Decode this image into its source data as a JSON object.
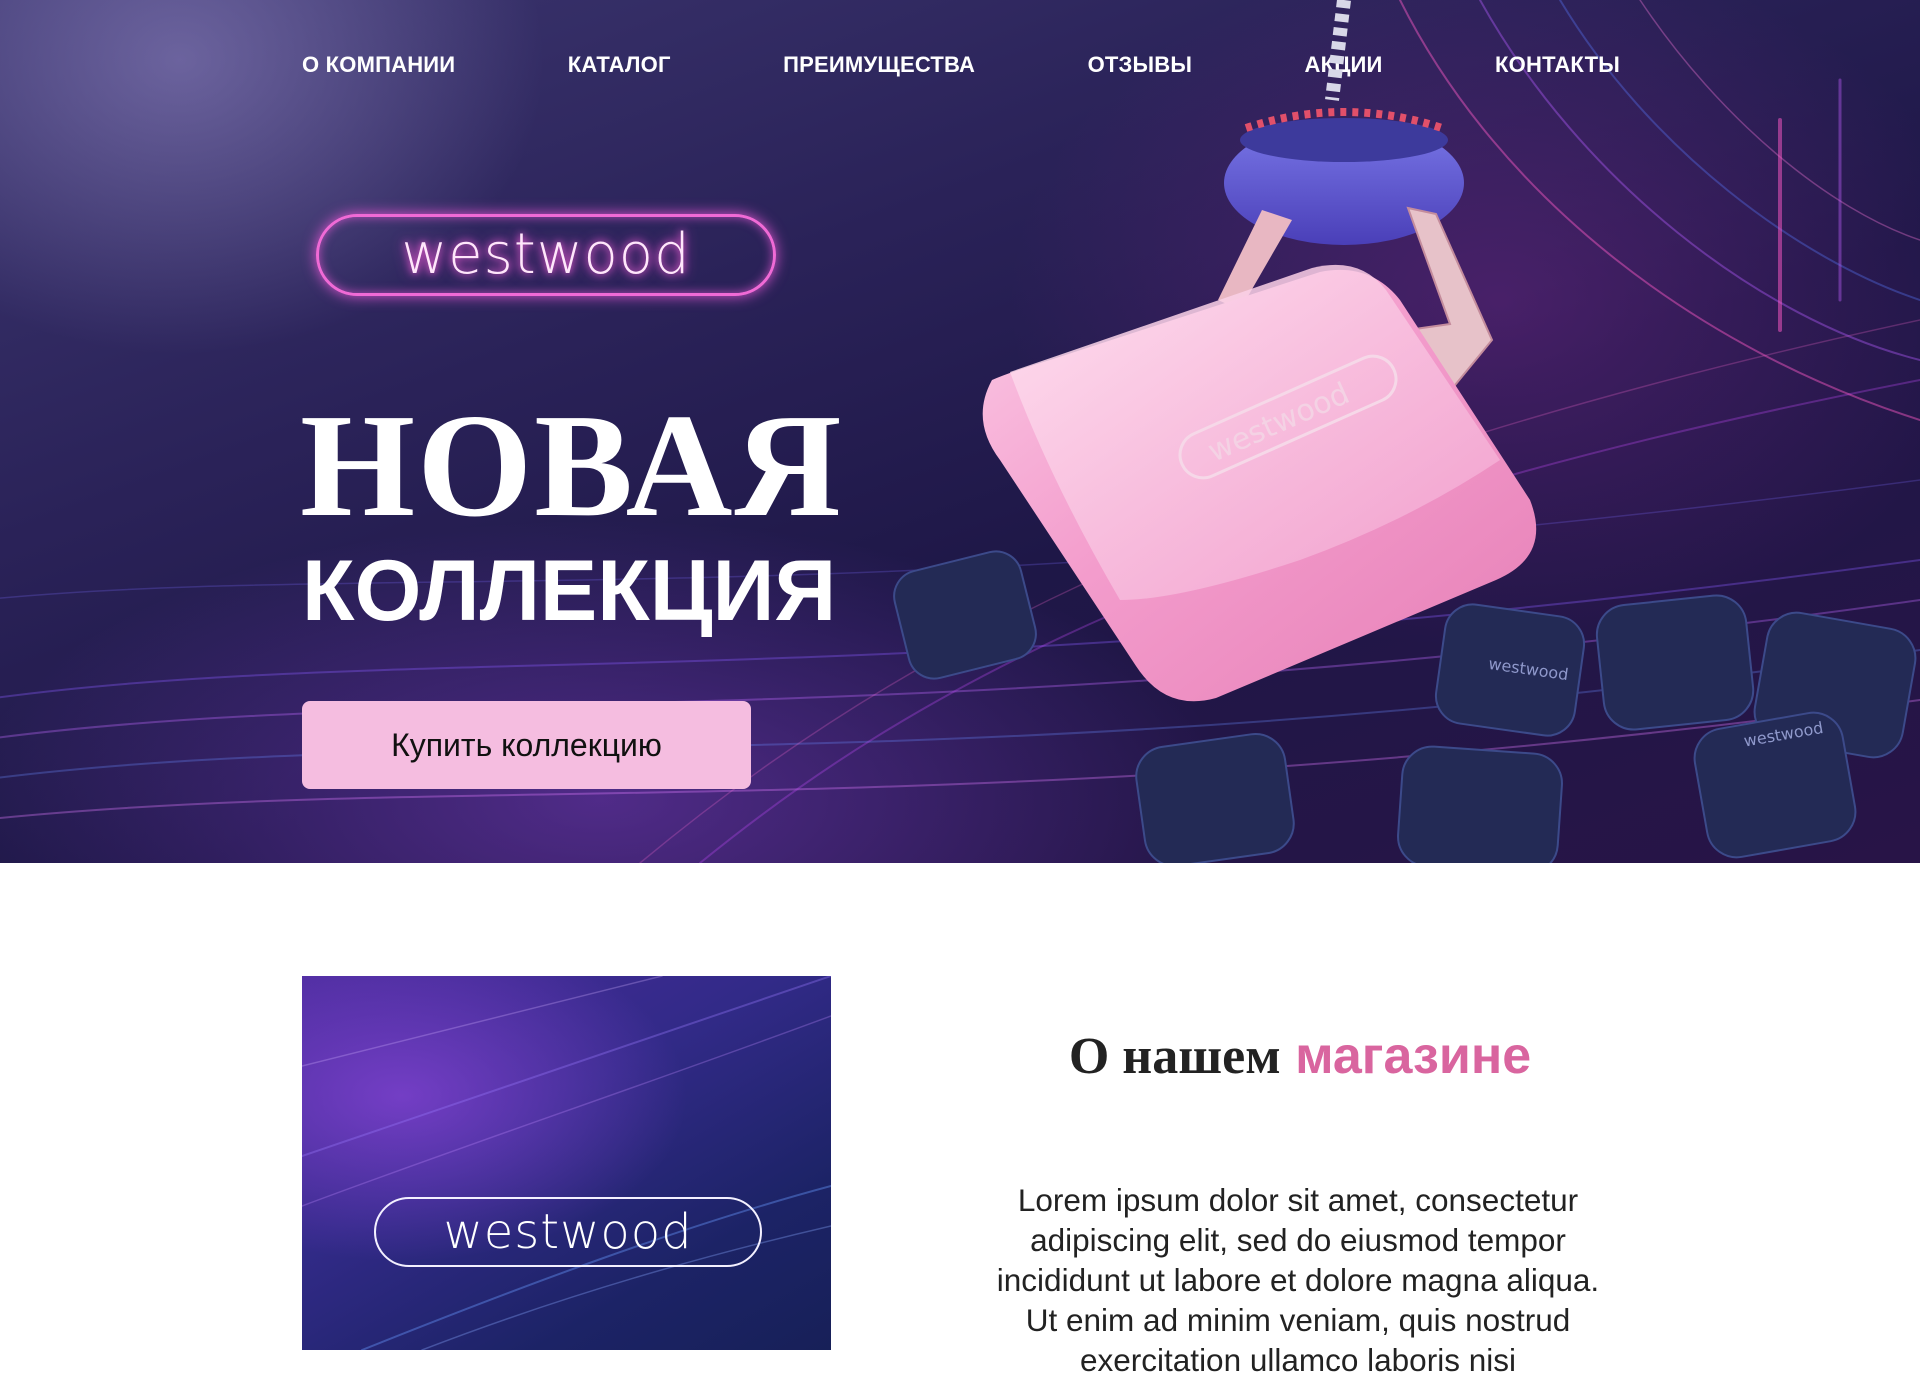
{
  "nav": {
    "items": [
      {
        "label": "О КОМПАНИИ"
      },
      {
        "label": "КАТАЛОГ"
      },
      {
        "label": "ПРЕИМУЩЕСТВА"
      },
      {
        "label": "ОТЗЫВЫ"
      },
      {
        "label": "АКЦИИ"
      },
      {
        "label": "КОНТАКТЫ"
      }
    ]
  },
  "hero": {
    "logo_text": "westwood",
    "title": "НОВАЯ",
    "subtitle": "КОЛЛЕКЦИЯ",
    "cta_label": "Купить коллекцию",
    "product_brand": "westwood",
    "background_brand": "westwood"
  },
  "about": {
    "image_logo_text": "westwood",
    "heading_part1": "О нашем",
    "heading_part2": "магазине",
    "text": "Lorem ipsum dolor sit amet, consectetur adipiscing elit, sed do eiusmod tempor incididunt ut labore et dolore magna aliqua. Ut enim ad minim veniam, quis nostrud exercitation ullamco laboris nisi"
  },
  "colors": {
    "accent_pink": "#d9659f",
    "button_pink": "#f5bde0",
    "neon_logo": "#f06ad6",
    "hero_bg": "#2a2258",
    "text_dark": "#222222"
  },
  "icons": {
    "product": "pink-pod-device",
    "claw": "claw-machine-grabber"
  }
}
